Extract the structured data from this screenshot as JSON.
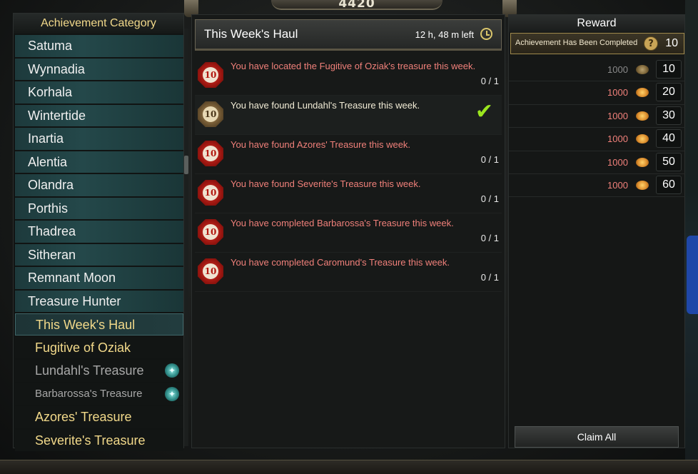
{
  "top": {
    "points": "4420"
  },
  "left": {
    "header": "Achievement Category",
    "categories": [
      {
        "label": "Satuma"
      },
      {
        "label": "Wynnadia"
      },
      {
        "label": "Korhala"
      },
      {
        "label": "Wintertide"
      },
      {
        "label": "Inartia"
      },
      {
        "label": "Alentia"
      },
      {
        "label": "Olandra"
      },
      {
        "label": "Porthis"
      },
      {
        "label": "Thadrea"
      },
      {
        "label": "Sitheran"
      },
      {
        "label": "Remnant Moon"
      },
      {
        "label": "Treasure Hunter"
      }
    ],
    "subcategories": [
      {
        "label": "This Week's Haul",
        "selected": true
      },
      {
        "label": "Fugitive of Oziak"
      },
      {
        "label": "Lundahl's Treasure",
        "muted": true,
        "gem": true
      },
      {
        "label": "Barbarossa's Treasure",
        "muted": true,
        "gem": true
      },
      {
        "label": "Azores' Treasure"
      },
      {
        "label": "Severite's Treasure"
      }
    ]
  },
  "middle": {
    "title": "This Week's Haul",
    "timer": "12 h, 48 m left",
    "achievements": [
      {
        "badge": "10",
        "text": "You have located the Fugitive of Oziak's treasure this week.",
        "progress": "0 / 1",
        "done": false
      },
      {
        "badge": "10",
        "text": "You have found Lundahl's Treasure this week.",
        "progress": "",
        "done": true
      },
      {
        "badge": "10",
        "text": "You have found Azores' Treasure this week.",
        "progress": "0 / 1",
        "done": false
      },
      {
        "badge": "10",
        "text": "You have found Severite's Treasure this week.",
        "progress": "0 / 1",
        "done": false
      },
      {
        "badge": "10",
        "text": "You have completed Barbarossa's Treasure this week.",
        "progress": "0 / 1",
        "done": false
      },
      {
        "badge": "10",
        "text": "You have completed Caromund's Treasure this week.",
        "progress": "0 / 1",
        "done": false
      }
    ]
  },
  "right": {
    "header": "Reward",
    "completed_label": "Achievement Has Been Completed",
    "completed_value": "10",
    "rewards": [
      {
        "amount": "1000",
        "value": "10",
        "done": true
      },
      {
        "amount": "1000",
        "value": "20",
        "done": false
      },
      {
        "amount": "1000",
        "value": "30",
        "done": false
      },
      {
        "amount": "1000",
        "value": "40",
        "done": false
      },
      {
        "amount": "1000",
        "value": "50",
        "done": false
      },
      {
        "amount": "1000",
        "value": "60",
        "done": false
      }
    ],
    "claim_all": "Claim All"
  },
  "colors": {
    "category_gold": "#f2d98a",
    "incomplete_text": "#f0807a",
    "complete_text": "#f2ecd6",
    "check": "#9be61e"
  }
}
